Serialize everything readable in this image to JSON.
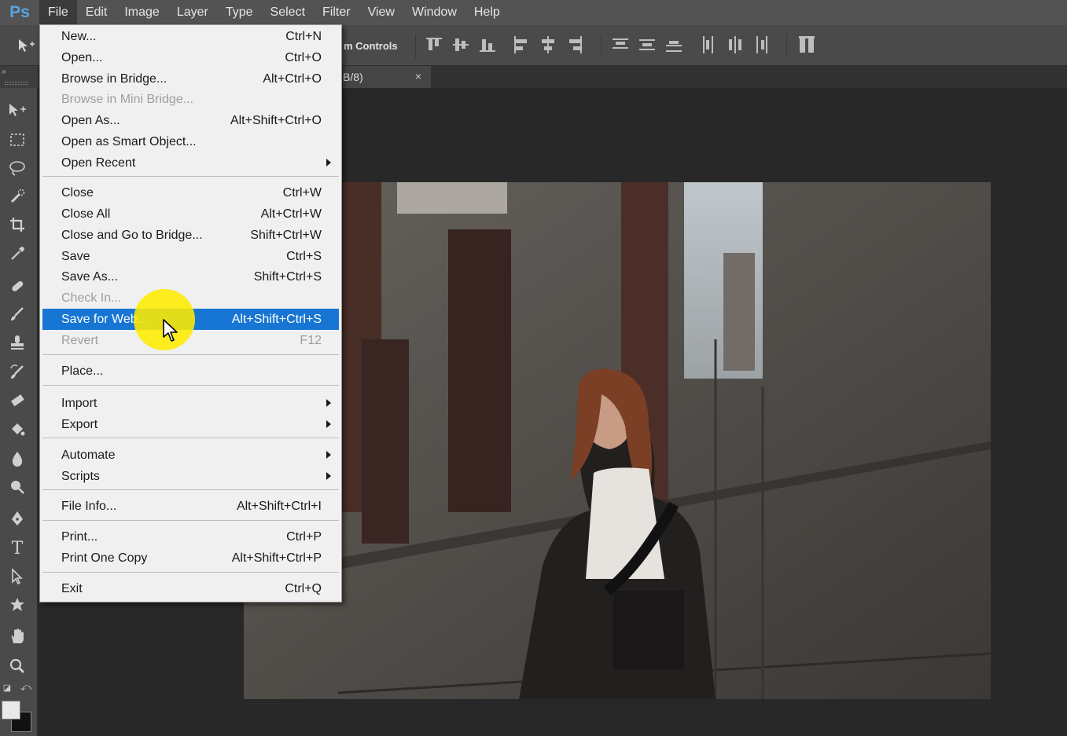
{
  "app": {
    "logo": "Ps"
  },
  "menubar": {
    "items": [
      "File",
      "Edit",
      "Image",
      "Layer",
      "Type",
      "Select",
      "Filter",
      "View",
      "Window",
      "Help"
    ]
  },
  "options_bar": {
    "transform_controls_label": "m Controls"
  },
  "document_tab": {
    "title": "B/8)",
    "close_glyph": "×"
  },
  "toolbar": {
    "tools": [
      "move-tool",
      "rectangular-marquee-tool",
      "lasso-tool",
      "quick-selection-tool",
      "crop-tool",
      "eyedropper-tool",
      "healing-brush-tool",
      "brush-tool",
      "clone-stamp-tool",
      "history-brush-tool",
      "eraser-tool",
      "paint-bucket-tool",
      "blur-tool",
      "dodge-tool",
      "pen-tool",
      "type-tool",
      "path-selection-tool",
      "custom-shape-tool",
      "hand-tool",
      "zoom-tool"
    ],
    "foreground_color": "#e9e9e9",
    "background_color": "#111111"
  },
  "file_menu": {
    "items": [
      {
        "label": "New...",
        "shortcut": "Ctrl+N"
      },
      {
        "label": "Open...",
        "shortcut": "Ctrl+O"
      },
      {
        "label": "Browse in Bridge...",
        "shortcut": "Alt+Ctrl+O"
      },
      {
        "label": "Browse in Mini Bridge...",
        "shortcut": ""
      },
      {
        "label": "Open As...",
        "shortcut": "Alt+Shift+Ctrl+O"
      },
      {
        "label": "Open as Smart Object...",
        "shortcut": ""
      },
      {
        "label": "Open Recent",
        "shortcut": ""
      },
      {
        "label": "Close",
        "shortcut": "Ctrl+W"
      },
      {
        "label": "Close All",
        "shortcut": "Alt+Ctrl+W"
      },
      {
        "label": "Close and Go to Bridge...",
        "shortcut": "Shift+Ctrl+W"
      },
      {
        "label": "Save",
        "shortcut": "Ctrl+S"
      },
      {
        "label": "Save As...",
        "shortcut": "Shift+Ctrl+S"
      },
      {
        "label": "Check In...",
        "shortcut": ""
      },
      {
        "label": "Save for Web...",
        "shortcut": "Alt+Shift+Ctrl+S"
      },
      {
        "label": "Revert",
        "shortcut": "F12"
      },
      {
        "label": "Place...",
        "shortcut": ""
      },
      {
        "label": "Import",
        "shortcut": ""
      },
      {
        "label": "Export",
        "shortcut": ""
      },
      {
        "label": "Automate",
        "shortcut": ""
      },
      {
        "label": "Scripts",
        "shortcut": ""
      },
      {
        "label": "File Info...",
        "shortcut": "Alt+Shift+Ctrl+I"
      },
      {
        "label": "Print...",
        "shortcut": "Ctrl+P"
      },
      {
        "label": "Print One Copy",
        "shortcut": "Alt+Shift+Ctrl+P"
      },
      {
        "label": "Exit",
        "shortcut": "Ctrl+Q"
      }
    ],
    "highlight_color": "#1776d4"
  }
}
